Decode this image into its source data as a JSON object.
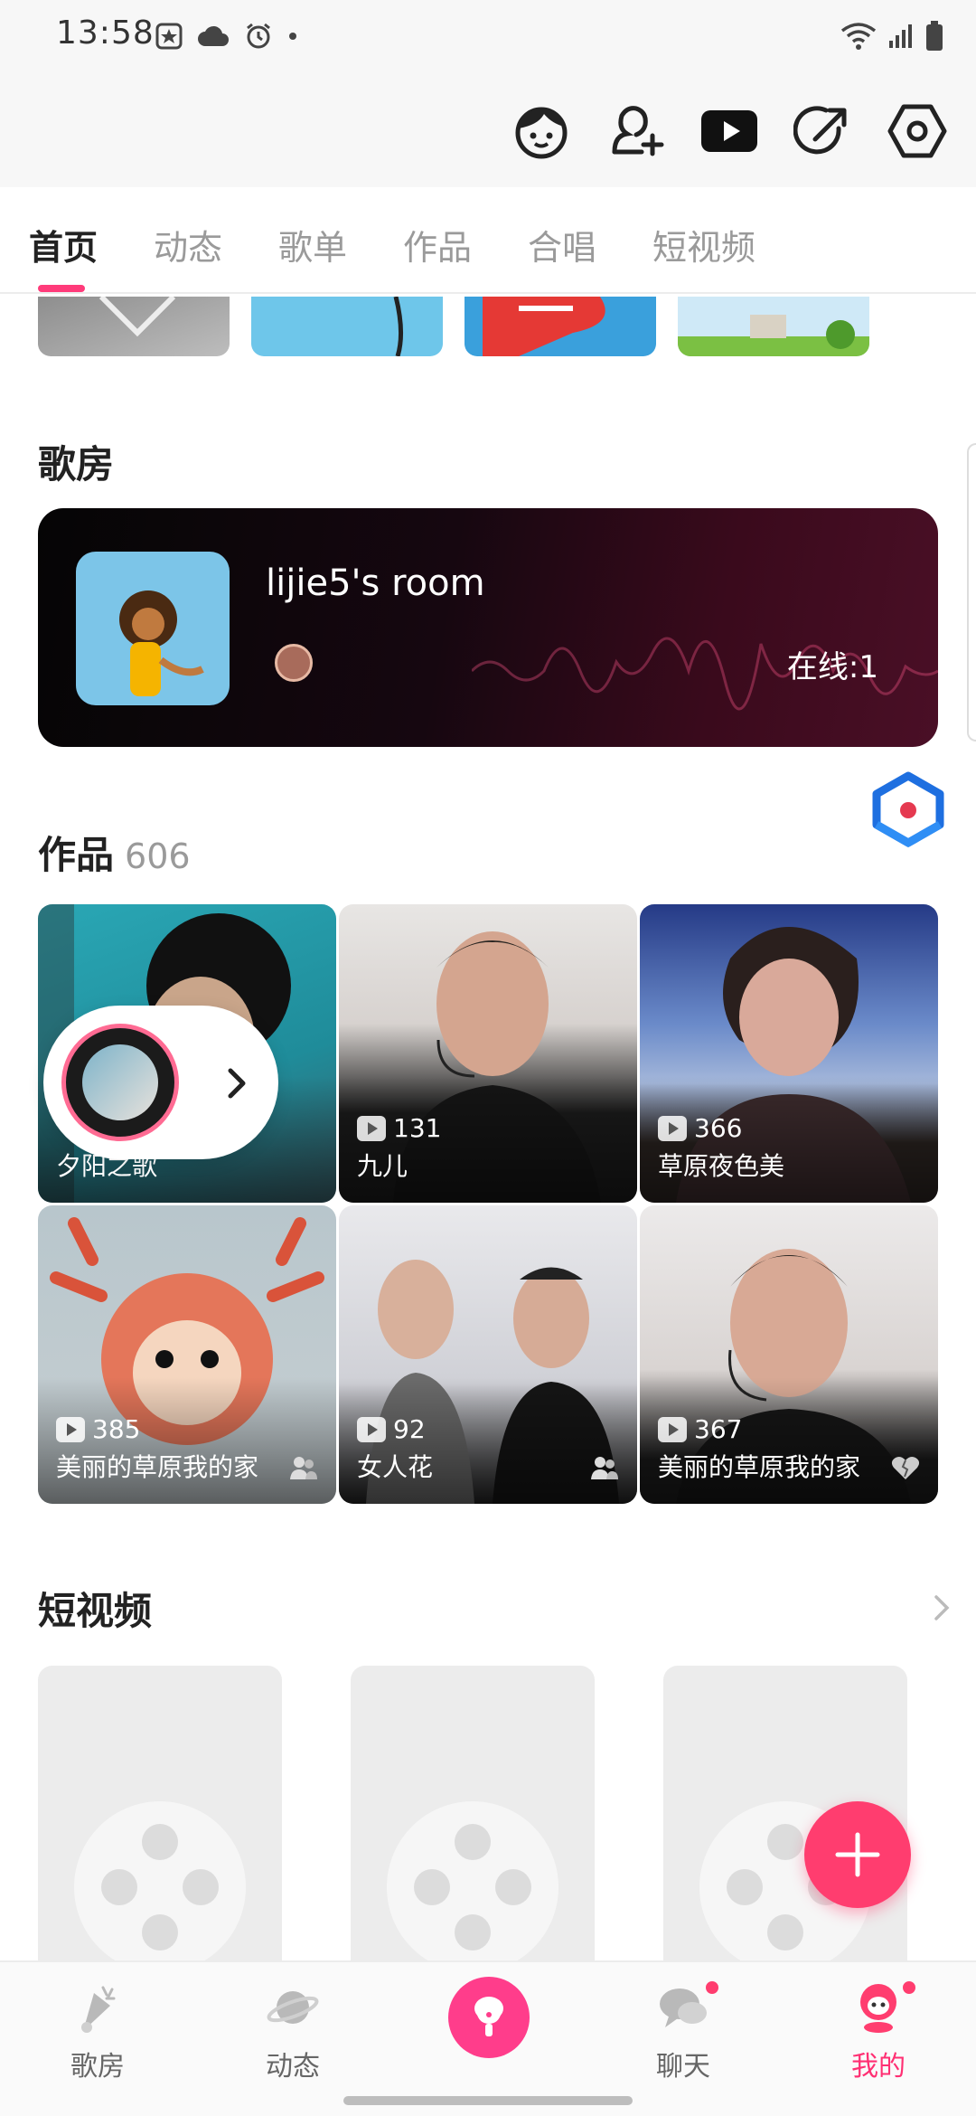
{
  "status_bar": {
    "time": "13:58"
  },
  "tabs": [
    {
      "label": "首页",
      "active": true
    },
    {
      "label": "动态",
      "active": false
    },
    {
      "label": "歌单",
      "active": false
    },
    {
      "label": "作品",
      "active": false
    },
    {
      "label": "合唱",
      "active": false
    },
    {
      "label": "短视频",
      "active": false
    }
  ],
  "room_section": {
    "title": "歌房",
    "room": {
      "name": "lijie5's room",
      "online": "在线:1"
    }
  },
  "works_section": {
    "title": "作品",
    "count": "606",
    "items": [
      {
        "title": "夕阳之歌",
        "plays": "",
        "duet": false
      },
      {
        "title": "九儿",
        "plays": "131",
        "duet": false
      },
      {
        "title": "草原夜色美",
        "plays": "366",
        "duet": false
      },
      {
        "title": "美丽的草原我的家",
        "plays": "385",
        "duet": true
      },
      {
        "title": "女人花",
        "plays": "92",
        "duet": true
      },
      {
        "title": "美丽的草原我的家",
        "plays": "367",
        "duet": true
      }
    ]
  },
  "short_video_section": {
    "title": "短视频"
  },
  "bottom_nav": [
    {
      "label": "歌房",
      "icon": "karaoke-room-icon",
      "active": false,
      "badge": false
    },
    {
      "label": "动态",
      "icon": "planet-icon",
      "active": false,
      "badge": false
    },
    {
      "label": "",
      "icon": "microphone-icon",
      "active": false,
      "badge": false
    },
    {
      "label": "聊天",
      "icon": "chat-icon",
      "active": false,
      "badge": true
    },
    {
      "label": "我的",
      "icon": "profile-icon",
      "active": true,
      "badge": true
    }
  ],
  "colors": {
    "accent": "#ff3d6f",
    "accent_text": "#ff2f73",
    "room_gradient_end": "#4a0f26"
  }
}
